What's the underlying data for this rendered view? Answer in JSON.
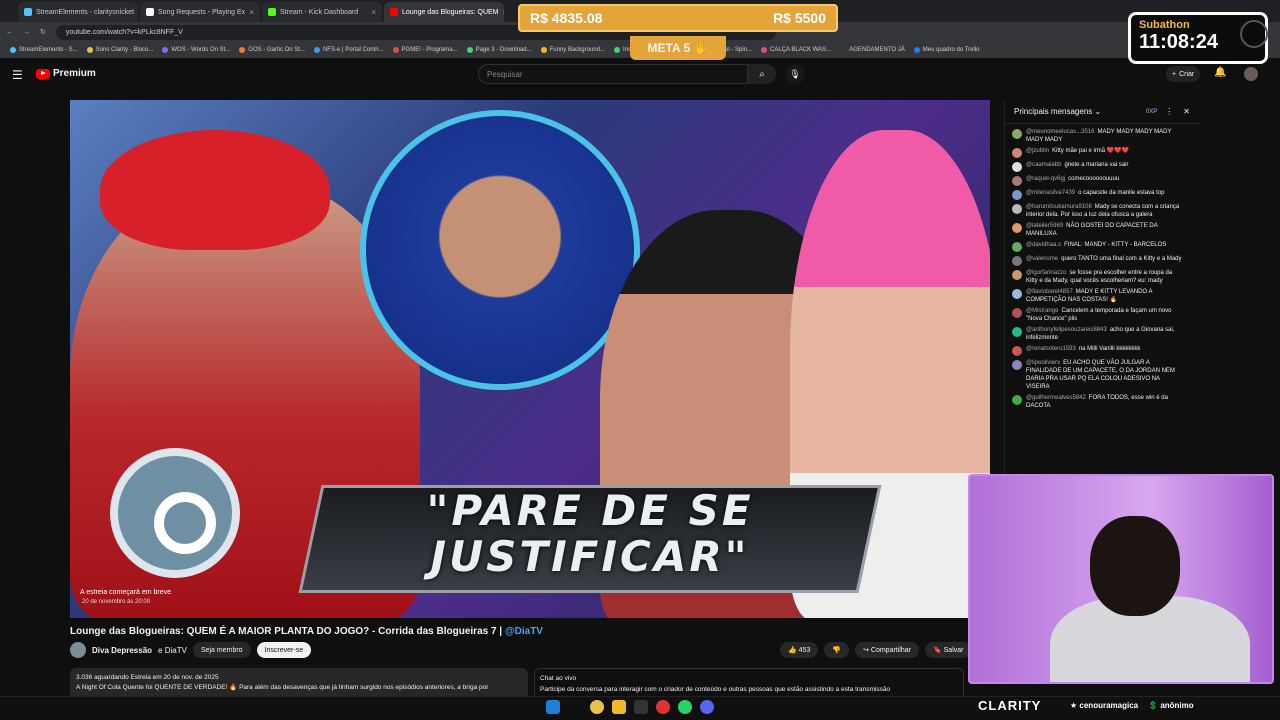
{
  "browser": {
    "tabs": [
      {
        "label": "StreamElements - claritysnicket",
        "color": "#57c3f8",
        "active": false
      },
      {
        "label": "Song Requests - Playing Ex",
        "color": "#ffffff",
        "active": false
      },
      {
        "label": "Stream - Kick Dashboard",
        "color": "#53fc18",
        "active": false
      },
      {
        "label": "Lounge das Blogueiras: QUEM",
        "color": "#ff0000",
        "active": true
      }
    ],
    "url": "youtube.com/watch?v=kPLkc8NFF_V",
    "bookmarks": [
      "StreamElements - S...",
      "Sons Clarity - Bloco...",
      "WOS - Words On St...",
      "GOS - Gartic On St...",
      "NFS-e | Portal Contri...",
      "PGME! - Programa...",
      "Page 3 - Download...",
      "Funny Background...",
      "Instant Backgroun...",
      "Picker Wheel - Spin...",
      "CALÇA BLACK WAS...",
      "AGENDAMENTO JÁ",
      "Meu quadro do Trello"
    ]
  },
  "youtube": {
    "logo": "Premium",
    "search_placeholder": "Pesquisar",
    "create_label": "Criar",
    "video": {
      "banner_line1": "\"PARE DE SE",
      "banner_line2": "JUSTIFICAR\"",
      "premiere_label": "A estreia começará em breve",
      "premiere_date": "20 de novembro às 20:00"
    },
    "title": "Lounge das Blogueiras: QUEM É A MAIOR PLANTA DO JOGO? - Corrida das Blogueiras 7 |",
    "title_tag": "@DiaTV",
    "channel": "Diva Depressão",
    "channel_collab": "e DiaTV",
    "join_label": "Seja membro",
    "subscribe_label": "Inscrever-se",
    "likes": "453",
    "share_label": "Compartilhar",
    "save_label": "Salvar",
    "desc_line1": "3.036 aguardando  Estreia em 20 de nov. de 2025",
    "desc_line2": "A Night Of Cola Quente foi QUENTE DE VERDADE! 🔥 Para além das desavenças que já tinham surgido nos episódios anteriores, a briga por",
    "live_chat_label": "Chat ao vivo",
    "live_chat_text": "Participe da conversa para interagir com o criador de conteúdo e outras pessoas que estão assistindo a esta transmissão"
  },
  "chat": {
    "header": "Principais mensagens",
    "points": "0XP",
    "messages": [
      {
        "user": "@meunomeelucas...3516",
        "text": "MADY MADY MADY MADY MADY MADY",
        "color": "#8a6"
      },
      {
        "user": "@jzublin",
        "text": "Kitty mãe pai e irmã ❤️❤️❤️",
        "color": "#c87"
      },
      {
        "user": "@caamaiabb",
        "text": "gnete a mariana vai sair",
        "color": "#ddd"
      },
      {
        "user": "@raquel-qv6gj",
        "text": "comecoooooouuuu",
        "color": "#a77"
      },
      {
        "user": "@milenasilva7439",
        "text": "o capacete da manile estava top",
        "color": "#79c"
      },
      {
        "user": "@harumitsukamura9108",
        "text": "Mady se conecta com a criança interior dela. Por isso a luz dela ofusca a galera",
        "color": "#bbb"
      },
      {
        "user": "@lateiler5969",
        "text": "NÃO GOSTEI DO CAPACETE DA MANILUXA",
        "color": "#d96"
      },
      {
        "user": "@davidhaa.s",
        "text": "FINAL: MANDY - KITTY - BARCELOS",
        "color": "#6a6"
      },
      {
        "user": "@valeriome",
        "text": "quero TANTO uma final com a Kitty e a Mady",
        "color": "#777"
      },
      {
        "user": "@lgorfarinazzo",
        "text": "se fosse pra escolher entre a roupa da Kitty e da Mady, qual vocês escolheriam? eu: mady",
        "color": "#c96"
      },
      {
        "user": "@flaviobarel4857",
        "text": "MADY E KITTY LEVANDO A COMPETIÇÃO NAS COSTAS! 🔥",
        "color": "#9bd"
      },
      {
        "user": "@Mistrange",
        "text": "Cancelem a temporada e façam um novo \"Nova Chance\" plis",
        "color": "#a55"
      },
      {
        "user": "@anthonyfelipesouzareis8843",
        "text": "acho que a Giovana sai, infelizmente",
        "color": "#2b8"
      },
      {
        "user": "@renatsotero1593",
        "text": "na Milli Vanilli kkkkkkkk",
        "color": "#c55"
      },
      {
        "user": "@lipeolivierx",
        "text": "EU ACHO QUE VÃO JULGAR A FINALIDADE DE UM CAPACETE, O DA JORDAN NEM DARIA PRA USAR PQ ELA COLOU ADESIVO NA VISEIRA",
        "color": "#88b"
      },
      {
        "user": "@guilhermealves5842",
        "text": "FORA TODOS, esse win é da DACOTA",
        "color": "#4a4"
      }
    ]
  },
  "overlay": {
    "donation_current": "R$ 4835.08",
    "donation_goal": "R$ 5500",
    "meta_label": "META 5",
    "subathon_label": "Subathon",
    "subathon_time": "11:08:24",
    "brand": "CLARITY",
    "ticker_user": "cenouramagica",
    "ticker_anon": "anônimo"
  }
}
